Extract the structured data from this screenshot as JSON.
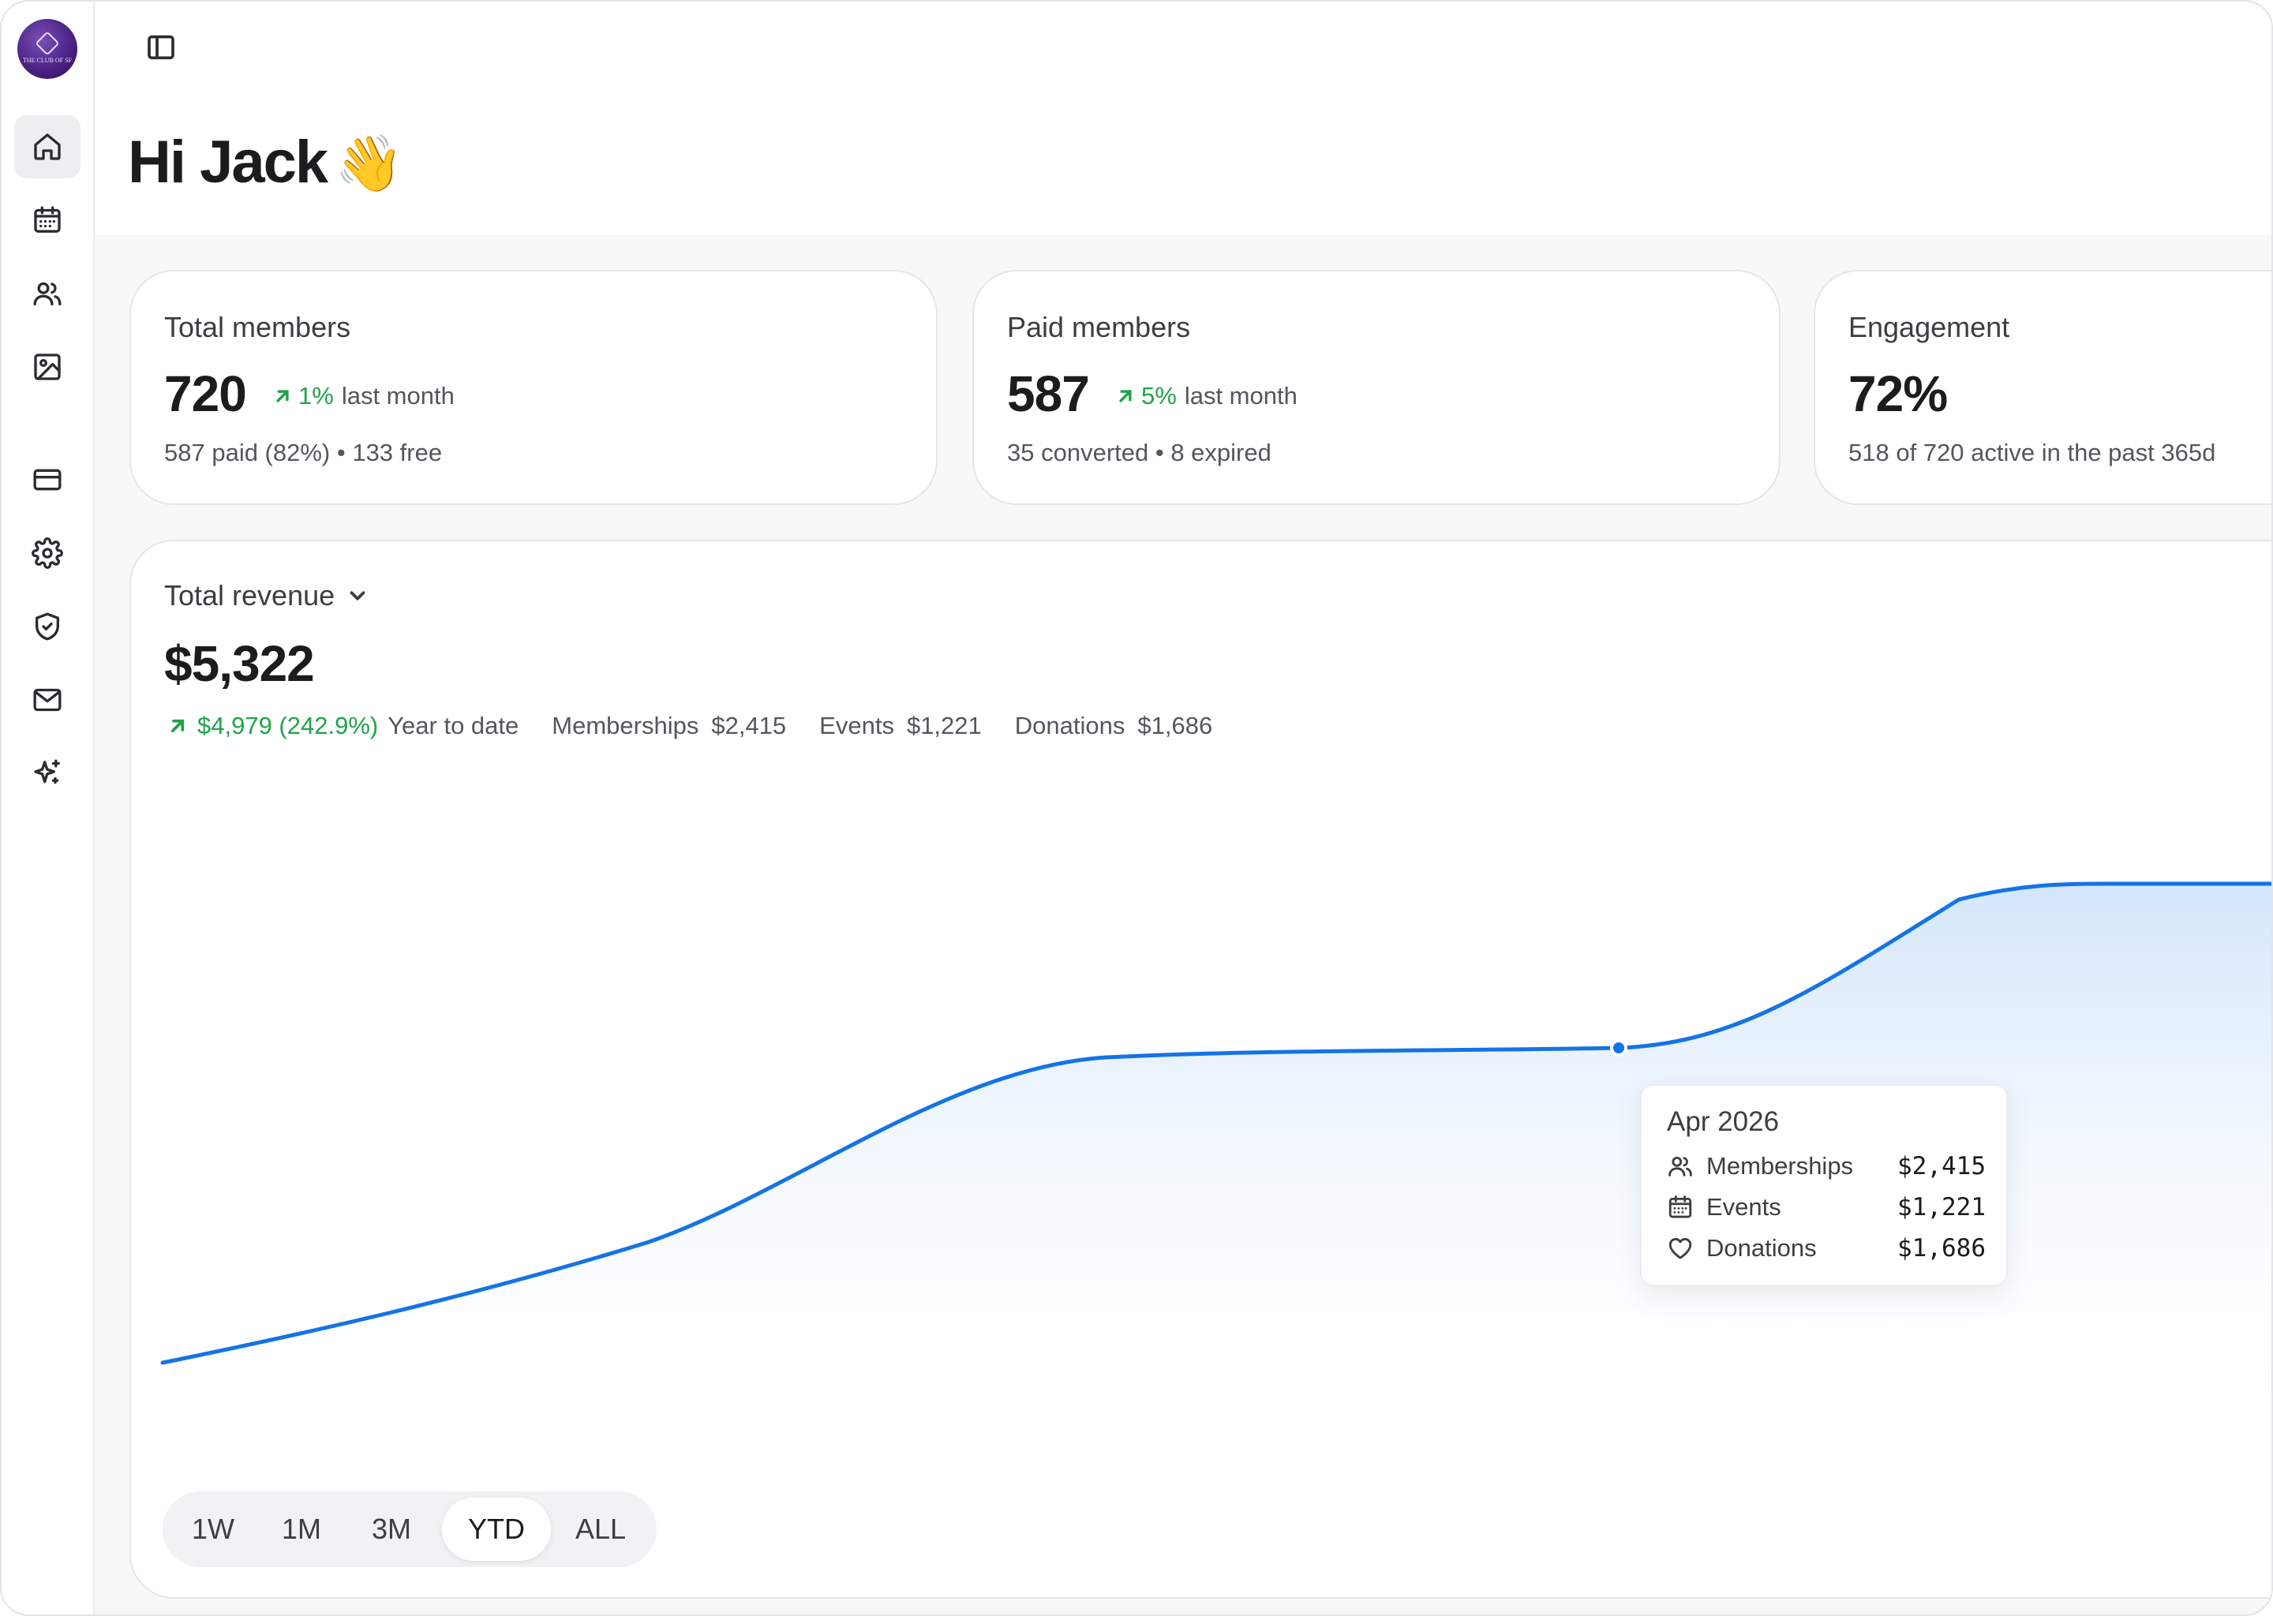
{
  "brand": {
    "logo_text": "THE CLUB OF SF"
  },
  "greeting": {
    "text": "Hi Jack",
    "emoji": "👋"
  },
  "sidebar": {
    "items": [
      {
        "name": "home",
        "icon": "home-icon",
        "active": true
      },
      {
        "name": "calendar",
        "icon": "calendar-icon"
      },
      {
        "name": "members",
        "icon": "users-icon"
      },
      {
        "name": "media",
        "icon": "image-icon"
      },
      {
        "name": "billing",
        "icon": "credit-card-icon"
      },
      {
        "name": "settings",
        "icon": "gear-icon"
      },
      {
        "name": "security",
        "icon": "shield-check-icon"
      },
      {
        "name": "mail",
        "icon": "mail-icon"
      },
      {
        "name": "ai",
        "icon": "sparkle-icon"
      }
    ]
  },
  "stats": [
    {
      "title": "Total members",
      "value": "720",
      "change": "1%",
      "change_label": "last month",
      "sub": "587 paid (82%) • 133 free"
    },
    {
      "title": "Paid members",
      "value": "587",
      "change": "5%",
      "change_label": "last month",
      "sub": "35 converted • 8 expired"
    },
    {
      "title": "Engagement",
      "value": "72%",
      "sub": "518 of 720 active in the past 365d"
    }
  ],
  "revenue": {
    "selector_label": "Total revenue",
    "value": "$5,322",
    "change": "$4,979 (242.9%)",
    "change_label": "Year to date",
    "breakdown": [
      {
        "label": "Memberships",
        "value": "$2,415"
      },
      {
        "label": "Events",
        "value": "$1,221"
      },
      {
        "label": "Donations",
        "value": "$1,686"
      }
    ]
  },
  "tooltip": {
    "title": "Apr 2026",
    "rows": [
      {
        "icon": "users-icon",
        "label": "Memberships",
        "value": "$2,415"
      },
      {
        "icon": "calendar-icon",
        "label": "Events",
        "value": "$1,221"
      },
      {
        "icon": "heart-icon",
        "label": "Donations",
        "value": "$1,686"
      }
    ]
  },
  "range": {
    "options": [
      "1W",
      "1M",
      "3M",
      "YTD",
      "ALL"
    ],
    "selected": "YTD"
  },
  "colors": {
    "accent": "#1473e6",
    "positive": "#1fa34a",
    "area": "#dbeafd"
  }
}
